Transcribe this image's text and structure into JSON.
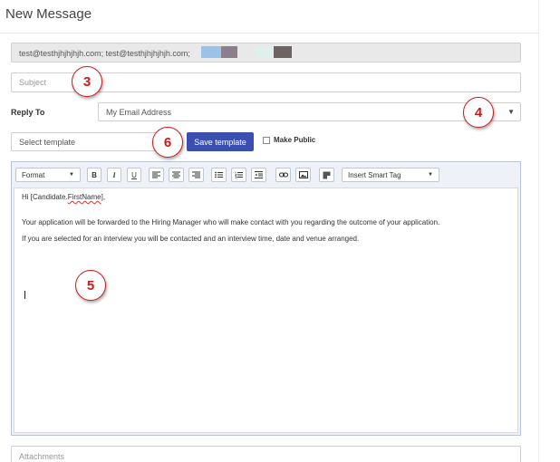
{
  "dialog": {
    "title": "New Message"
  },
  "to": {
    "value": "test@testhjhjhjhjh.com; test@testhjhjhjhjh.com;"
  },
  "redactions": [
    {
      "color": "#9bc3ea"
    },
    {
      "color": "#8a7f8a"
    },
    {
      "color": "#dfefec"
    },
    {
      "color": "#6d6362"
    }
  ],
  "subject": {
    "placeholder": "Subject"
  },
  "reply_to": {
    "label": "Reply To",
    "value": "My Email Address"
  },
  "template": {
    "placeholder": "Select template",
    "save_label": "Save template",
    "make_public_label": "Make Public",
    "make_public_checked": false
  },
  "toolbar": {
    "format_label": "Format",
    "bold_label": "B",
    "italic_label": "I",
    "underline_label": "U",
    "smart_tag_label": "Insert Smart Tag"
  },
  "body": {
    "greeting_prefix": "Hi [Candidate.",
    "greeting_token": "FirstName",
    "greeting_suffix": "],",
    "paragraph_1": "Your application will be forwarded to the Hiring Manager who will make contact with you regarding the outcome of your application.",
    "paragraph_2": "If you are selected for an interview you will be contacted and an interview time, date and venue arranged."
  },
  "attachments": {
    "placeholder": "Attachments"
  },
  "annotations": {
    "m3": "3",
    "m4": "4",
    "m5": "5",
    "m6": "6"
  },
  "colors": {
    "accent": "#3a4fb0",
    "marker": "#cc1a1a"
  }
}
